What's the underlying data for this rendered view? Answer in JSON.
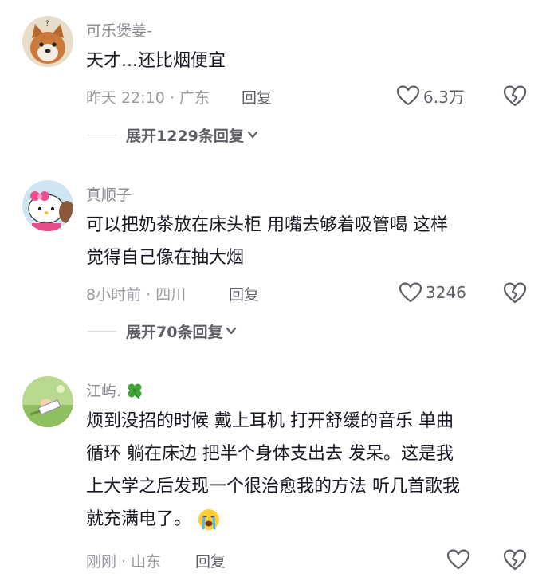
{
  "comments": [
    {
      "username": "可乐煲姜-",
      "lines": [
        "天才...还比烟便宜"
      ],
      "time_location": "昨天 22:10 · 广东",
      "reply_label": "回复",
      "like_count": "6.3万",
      "expand_label": "展开1229条回复"
    },
    {
      "username": "真顺子",
      "lines": [
        "可以把奶茶放在床头柜 用嘴去够着吸管喝 这样",
        "觉得自己像在抽大烟"
      ],
      "time_location": "8小时前 · 四川",
      "reply_label": "回复",
      "like_count": "3246",
      "expand_label": "展开70条回复"
    },
    {
      "username": "江屿.",
      "username_emoji": "four-leaf-clover",
      "lines": [
        "烦到没招的时候 戴上耳机 打开舒缓的音乐 单曲",
        "循环  躺在床边 把半个身体支出去  发呆。这是我",
        "上大学之后发现一个很治愈我的方法 听几首歌我",
        "就充满电了。"
      ],
      "trailing_emoji": "crying-face",
      "time_location": "刚刚 · 山东",
      "reply_label": "回复",
      "like_count": ""
    }
  ],
  "icons": {
    "like": "heart-outline-icon",
    "dislike": "broken-heart-icon",
    "expand": "chevron-down-icon"
  },
  "colors": {
    "text_primary": "#161823",
    "text_secondary": "#8a8b91",
    "icon_gray": "#5e5f66"
  }
}
